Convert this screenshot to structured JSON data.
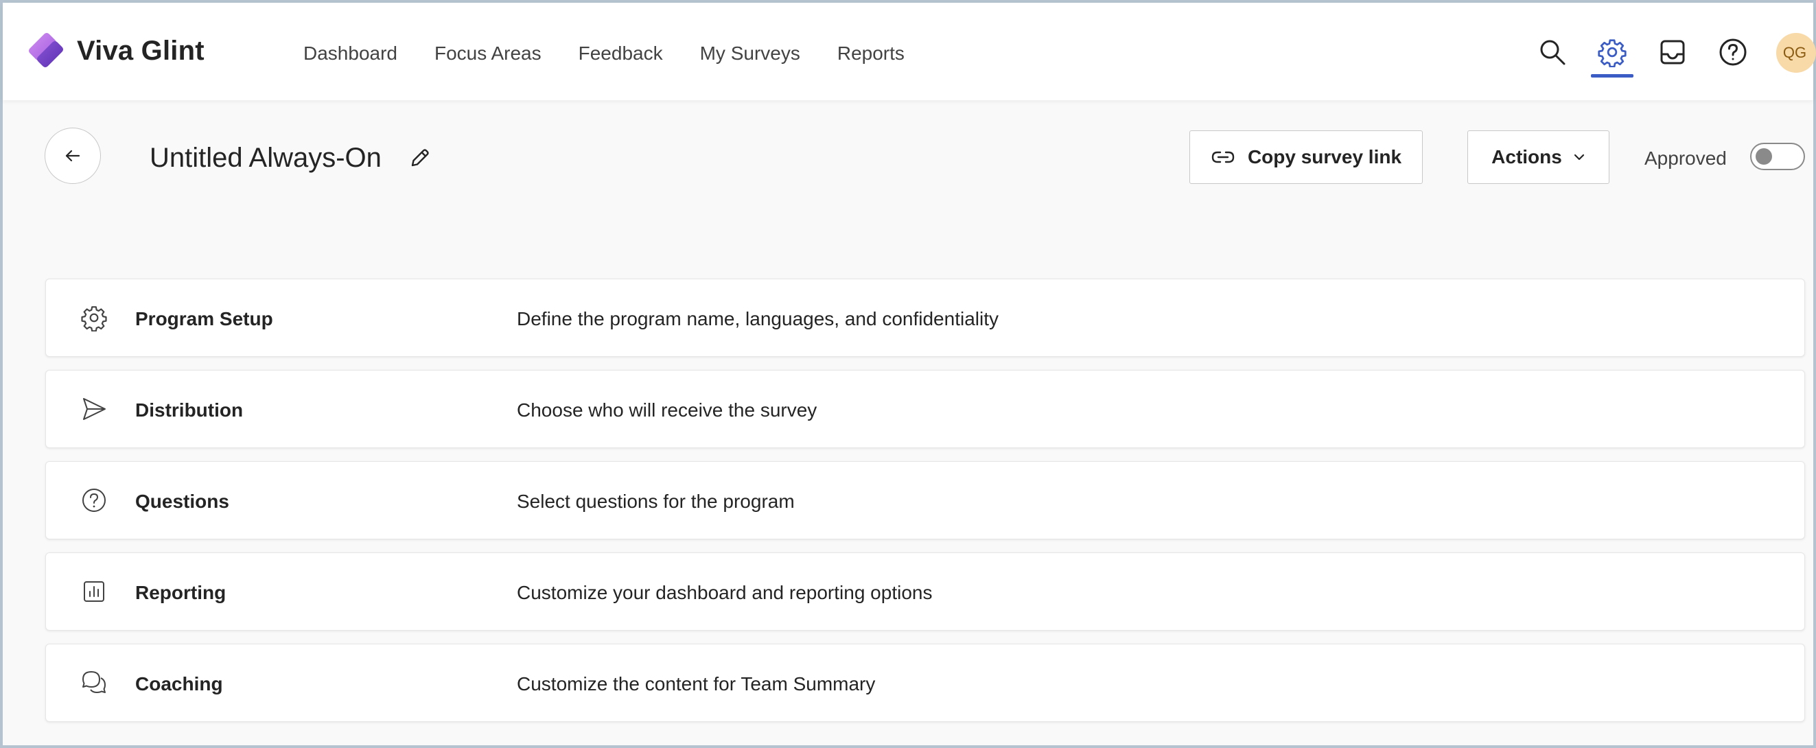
{
  "app": {
    "brand": "Viva Glint"
  },
  "nav": {
    "items": [
      {
        "label": "Dashboard"
      },
      {
        "label": "Focus Areas"
      },
      {
        "label": "Feedback"
      },
      {
        "label": "My Surveys"
      },
      {
        "label": "Reports"
      }
    ]
  },
  "topbar": {
    "icons": [
      "search-icon",
      "gear-icon",
      "inbox-icon",
      "help-icon"
    ],
    "avatar_initials": "QG",
    "active_icon": "gear-icon",
    "accent_color": "#3b5cc4"
  },
  "header": {
    "title": "Untitled Always-On",
    "copy_link_label": "Copy survey link",
    "actions_label": "Actions",
    "approved_label": "Approved",
    "approved_on": false
  },
  "sections": [
    {
      "icon": "gear-icon",
      "title": "Program Setup",
      "description": "Define the program name, languages, and confidentiality"
    },
    {
      "icon": "send-icon",
      "title": "Distribution",
      "description": "Choose who will receive the survey"
    },
    {
      "icon": "question-circle-icon",
      "title": "Questions",
      "description": "Select questions for the program"
    },
    {
      "icon": "chart-icon",
      "title": "Reporting",
      "description": "Customize your dashboard and reporting options"
    },
    {
      "icon": "chat-bubbles-icon",
      "title": "Coaching",
      "description": "Customize the content for Team Summary"
    }
  ]
}
